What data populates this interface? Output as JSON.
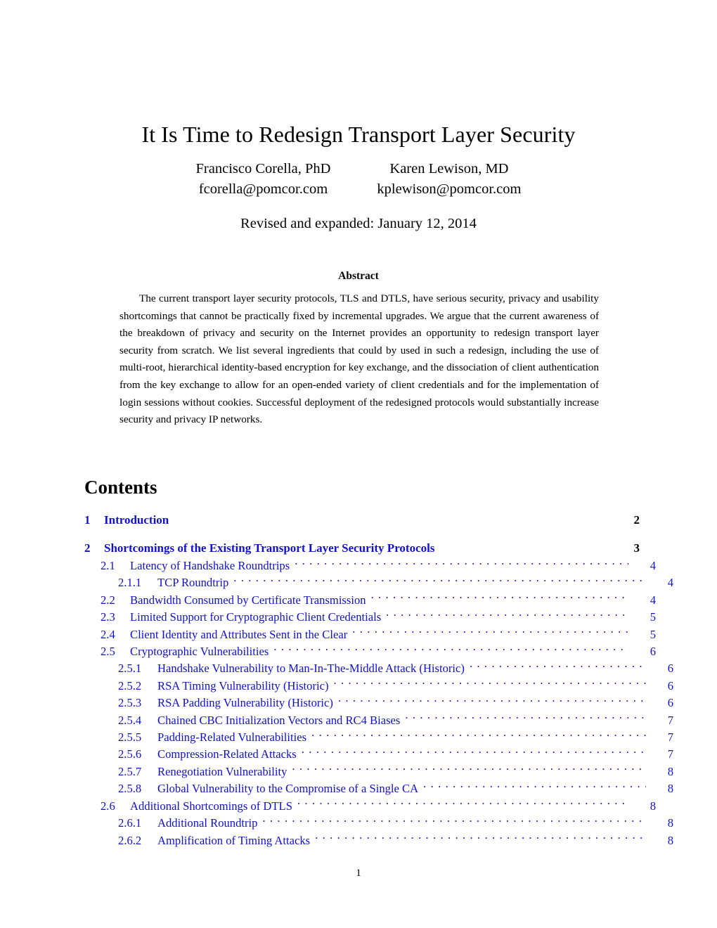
{
  "title": "It Is Time to Redesign Transport Layer Security",
  "authors": [
    {
      "name": "Francisco Corella, PhD",
      "email": "fcorella@pomcor.com"
    },
    {
      "name": "Karen Lewison, MD",
      "email": "kplewison@pomcor.com"
    }
  ],
  "revised": "Revised and expanded: January 12, 2014",
  "abstract": {
    "heading": "Abstract",
    "body": "The current transport layer security protocols, TLS and DTLS, have serious security, privacy and usability shortcomings that cannot be practically fixed by incremental upgrades. We argue that the current awareness of the breakdown of privacy and security on the Internet provides an opportunity to redesign transport layer security from scratch. We list several ingredients that could by used in such a redesign, including the use of multi-root, hierarchical identity-based encryption for key exchange, and the dissociation of client authentication from the key exchange to allow for an open-ended variety of client credentials and for the implementation of login sessions without cookies. Successful deployment of the redesigned protocols would substantially increase security and privacy IP networks."
  },
  "contents": {
    "heading": "Contents",
    "link_color": "#1111cc",
    "entries": [
      {
        "level": "section",
        "number": "1",
        "label": "Introduction",
        "page": "2"
      },
      {
        "level": "section",
        "number": "2",
        "label": "Shortcomings of the Existing Transport Layer Security Protocols",
        "page": "3"
      },
      {
        "level": "subsection",
        "number": "2.1",
        "label": "Latency of Handshake Roundtrips",
        "page": "4"
      },
      {
        "level": "subsubsection",
        "number": "2.1.1",
        "label": "TCP Roundtrip",
        "page": "4"
      },
      {
        "level": "subsection",
        "number": "2.2",
        "label": "Bandwidth Consumed by Certificate Transmission",
        "page": "4"
      },
      {
        "level": "subsection",
        "number": "2.3",
        "label": "Limited Support for Cryptographic Client Credentials",
        "page": "5"
      },
      {
        "level": "subsection",
        "number": "2.4",
        "label": "Client Identity and Attributes Sent in the Clear",
        "page": "5"
      },
      {
        "level": "subsection",
        "number": "2.5",
        "label": "Cryptographic Vulnerabilities",
        "page": "6"
      },
      {
        "level": "subsubsection",
        "number": "2.5.1",
        "label": "Handshake Vulnerability to Man-In-The-Middle Attack (Historic)",
        "page": "6"
      },
      {
        "level": "subsubsection",
        "number": "2.5.2",
        "label": "RSA Timing Vulnerability (Historic)",
        "page": "6"
      },
      {
        "level": "subsubsection",
        "number": "2.5.3",
        "label": "RSA Padding Vulnerability (Historic)",
        "page": "6"
      },
      {
        "level": "subsubsection",
        "number": "2.5.4",
        "label": "Chained CBC Initialization Vectors and RC4 Biases",
        "page": "7"
      },
      {
        "level": "subsubsection",
        "number": "2.5.5",
        "label": "Padding-Related Vulnerabilities",
        "page": "7"
      },
      {
        "level": "subsubsection",
        "number": "2.5.6",
        "label": "Compression-Related Attacks",
        "page": "7"
      },
      {
        "level": "subsubsection",
        "number": "2.5.7",
        "label": "Renegotiation Vulnerability",
        "page": "8"
      },
      {
        "level": "subsubsection",
        "number": "2.5.8",
        "label": "Global Vulnerability to the Compromise of a Single CA",
        "page": "8"
      },
      {
        "level": "subsection",
        "number": "2.6",
        "label": "Additional Shortcomings of DTLS",
        "page": "8"
      },
      {
        "level": "subsubsection",
        "number": "2.6.1",
        "label": "Additional Roundtrip",
        "page": "8"
      },
      {
        "level": "subsubsection",
        "number": "2.6.2",
        "label": "Amplification of Timing Attacks",
        "page": "8"
      }
    ]
  },
  "footer": {
    "page_number": "1"
  }
}
